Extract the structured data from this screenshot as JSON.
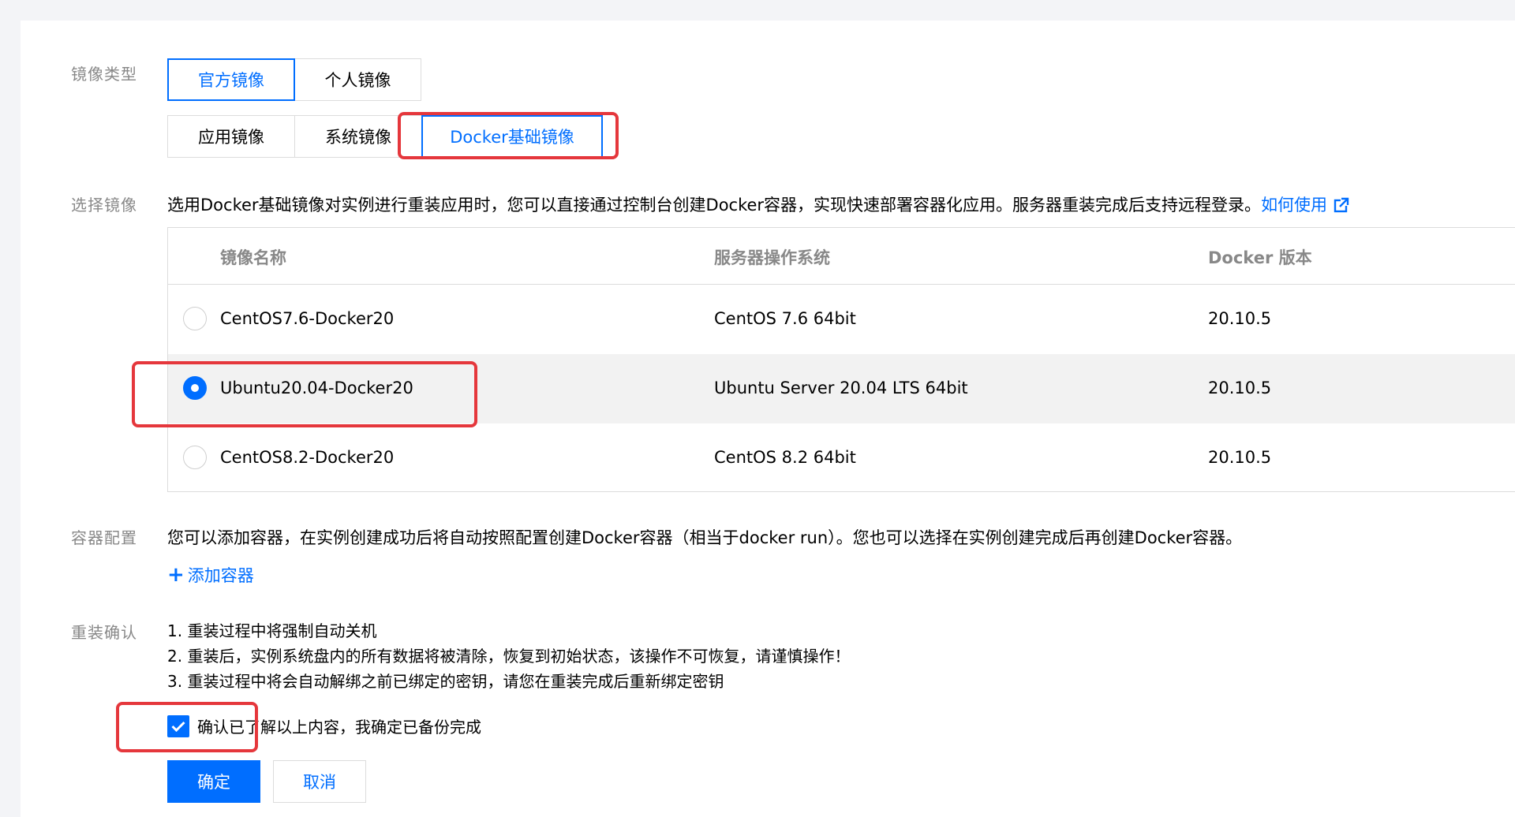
{
  "image_type": {
    "label": "镜像类型",
    "tabs_row1": [
      "官方镜像",
      "个人镜像"
    ],
    "tabs_row2": [
      "应用镜像",
      "系统镜像",
      "Docker基础镜像"
    ],
    "active_row1": "官方镜像",
    "active_row2": "Docker基础镜像"
  },
  "select_image": {
    "label": "选择镜像",
    "description": "选用Docker基础镜像对实例进行重装应用时，您可以直接通过控制台创建Docker容器，实现快速部署容器化应用。服务器重装完成后支持远程登录。",
    "help_link": "如何使用",
    "help_link_icon": "external-link-icon",
    "columns": [
      "镜像名称",
      "服务器操作系统",
      "Docker 版本"
    ],
    "rows": [
      {
        "name": "CentOS7.6-Docker20",
        "os": "CentOS 7.6 64bit",
        "docker": "20.10.5",
        "selected": false
      },
      {
        "name": "Ubuntu20.04-Docker20",
        "os": "Ubuntu Server 20.04 LTS 64bit",
        "docker": "20.10.5",
        "selected": true
      },
      {
        "name": "CentOS8.2-Docker20",
        "os": "CentOS 8.2 64bit",
        "docker": "20.10.5",
        "selected": false
      }
    ]
  },
  "container_config": {
    "label": "容器配置",
    "description": "您可以添加容器，在实例创建成功后将自动按照配置创建Docker容器（相当于docker run）。您也可以选择在实例创建完成后再创建Docker容器。",
    "add_button": "添加容器",
    "add_icon": "plus-icon"
  },
  "reinstall_confirm": {
    "label": "重装确认",
    "notes": [
      "1. 重装过程中将强制自动关机",
      "2. 重装后，实例系统盘内的所有数据将被清除，恢复到初始状态，该操作不可恢复，请谨慎操作！",
      "3. 重装过程中将会自动解绑之前已绑定的密钥，请您在重装完成后重新绑定密钥"
    ],
    "checkbox_label": "确认已了解以上内容，我确定已备份完成",
    "checkbox_checked": true,
    "checkbox_icon": "checkmark-icon"
  },
  "actions": {
    "confirm": "确定",
    "cancel": "取消"
  },
  "colors": {
    "accent": "#006eff",
    "highlight_border": "#e5373c",
    "label_gray": "#888888",
    "selected_row_bg": "#f2f2f2"
  }
}
